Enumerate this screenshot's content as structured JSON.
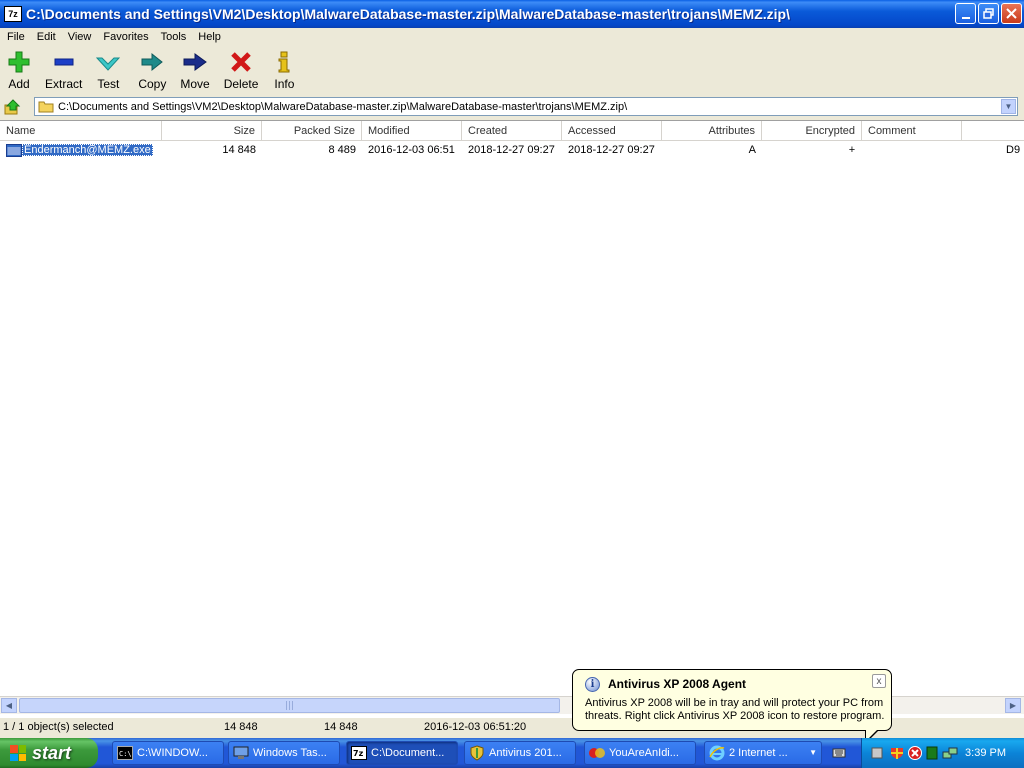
{
  "window": {
    "title": "C:\\Documents and Settings\\VM2\\Desktop\\MalwareDatabase-master.zip\\MalwareDatabase-master\\trojans\\MEMZ.zip\\",
    "icon_text": "7z",
    "title_color": "#0a5ad9"
  },
  "menu": {
    "items": [
      "File",
      "Edit",
      "View",
      "Favorites",
      "Tools",
      "Help"
    ]
  },
  "toolbar": {
    "buttons": [
      {
        "label": "Add",
        "icon": "plus-icon"
      },
      {
        "label": "Extract",
        "icon": "minus-icon"
      },
      {
        "label": "Test",
        "icon": "checkmark-icon"
      },
      {
        "label": "Copy",
        "icon": "arrow-right-icon"
      },
      {
        "label": "Move",
        "icon": "arrow-right-icon"
      },
      {
        "label": "Delete",
        "icon": "x-icon"
      },
      {
        "label": "Info",
        "icon": "info-icon"
      }
    ]
  },
  "address": {
    "path": "C:\\Documents and Settings\\VM2\\Desktop\\MalwareDatabase-master.zip\\MalwareDatabase-master\\trojans\\MEMZ.zip\\"
  },
  "columns": [
    "Name",
    "Size",
    "Packed Size",
    "Modified",
    "Created",
    "Accessed",
    "Attributes",
    "Encrypted",
    "Comment"
  ],
  "files": [
    {
      "name": "Endermanch@MEMZ.exe",
      "size": "14 848",
      "packed_size": "8 489",
      "modified": "2016-12-03 06:51",
      "created": "2018-12-27 09:27",
      "accessed": "2018-12-27 09:27",
      "attributes": "A",
      "encrypted": "+",
      "comment": "",
      "extra": "D9"
    }
  ],
  "status": {
    "selection": "1 / 1 object(s) selected",
    "size": "14 848",
    "packed": "14 848",
    "modified": "2016-12-03 06:51:20"
  },
  "balloon": {
    "title": "Antivirus XP 2008 Agent",
    "text": "Antivirus XP 2008 will be in tray and will protect your PC from threats. Right click Antivirus XP 2008 icon to restore program.",
    "close": "x"
  },
  "taskbar": {
    "start_label": "start",
    "buttons": [
      {
        "label": "C:\\WINDOW...",
        "icon": "cmd-icon"
      },
      {
        "label": "Windows Tas...",
        "icon": "task-manager-icon"
      },
      {
        "label": "C:\\Document...",
        "icon": "7zip-icon"
      },
      {
        "label": "Antivirus 201...",
        "icon": "shield-icon"
      },
      {
        "label": "YouAreAnIdi...",
        "icon": "app-icon"
      },
      {
        "label": "2 Internet ...",
        "icon": "internet-explorer-icon"
      }
    ],
    "clock": "3:39 PM"
  }
}
